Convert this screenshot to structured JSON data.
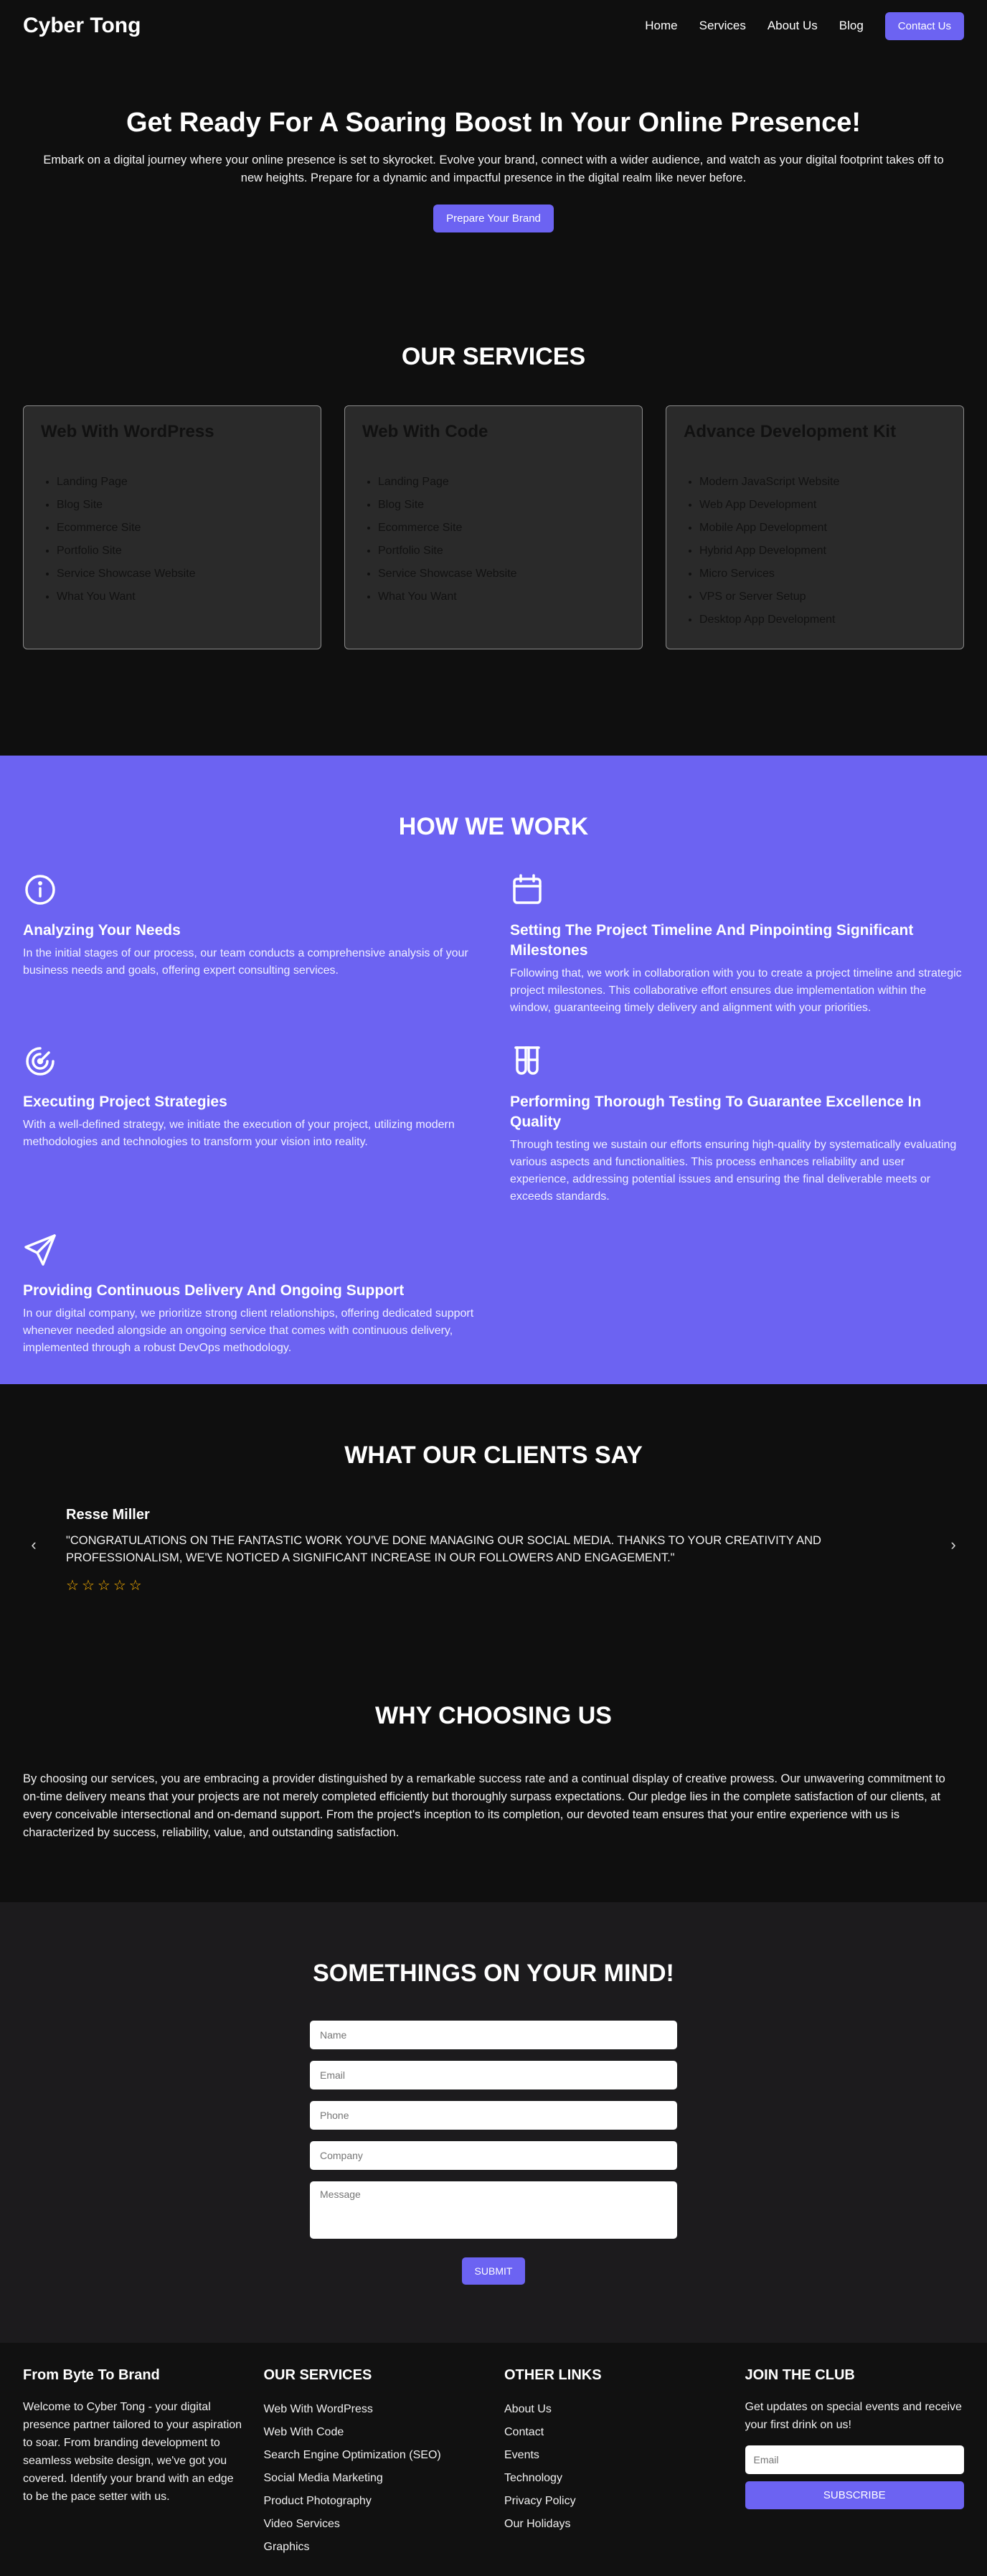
{
  "nav": {
    "logo": "Cyber Tong",
    "links": [
      "Home",
      "Services",
      "About Us",
      "Blog"
    ],
    "cta": "Contact Us"
  },
  "hero": {
    "title": "Get Ready For A Soaring Boost In Your Online Presence!",
    "text": "Embark on a digital journey where your online presence is set to skyrocket. Evolve your brand, connect with a wider audience, and watch as your digital footprint takes off to new heights. Prepare for a dynamic and impactful presence in the digital realm like never before.",
    "button": "Prepare Your Brand"
  },
  "services": {
    "title": "OUR SERVICES",
    "cards": [
      {
        "title": "Web With WordPress",
        "items": [
          "Landing Page",
          "Blog Site",
          "Ecommerce Site",
          "Portfolio Site",
          "Service Showcase Website",
          "What You Want"
        ]
      },
      {
        "title": "Web With Code",
        "items": [
          "Landing Page",
          "Blog Site",
          "Ecommerce Site",
          "Portfolio Site",
          "Service Showcase Website",
          "What You Want"
        ]
      },
      {
        "title": "Advance Development Kit",
        "items": [
          "Modern JavaScript Website",
          "Web App Development",
          "Mobile App Development",
          "Hybrid App Development",
          "Micro Services",
          "VPS or Server Setup",
          "Desktop App Development"
        ]
      }
    ]
  },
  "how": {
    "title": "HOW WE WORK",
    "items": [
      {
        "icon": "info-icon",
        "title": "Analyzing Your Needs",
        "text": "In the initial stages of our process, our team conducts a comprehensive analysis of your business needs and goals, offering expert consulting services."
      },
      {
        "icon": "calendar-icon",
        "title": "Setting The Project Timeline And Pinpointing Significant Milestones",
        "text": "Following that, we work in collaboration with you to create a project timeline and strategic project milestones. This collaborative effort ensures due implementation within the window, guaranteeing timely delivery and alignment with your priorities."
      },
      {
        "icon": "target-icon",
        "title": "Executing Project Strategies",
        "text": "With a well-defined strategy, we initiate the execution of your project, utilizing modern methodologies and technologies to transform your vision into reality."
      },
      {
        "icon": "test-tubes-icon",
        "title": "Performing Thorough Testing To Guarantee Excellence In Quality",
        "text": "Through testing we sustain our efforts ensuring high-quality by systematically evaluating various aspects and functionalities. This process enhances reliability and user experience, addressing potential issues and ensuring the final deliverable meets or exceeds standards."
      },
      {
        "icon": "send-icon",
        "title": "Providing Continuous Delivery And Ongoing Support",
        "text": "In our digital company, we prioritize strong client relationships, offering dedicated support whenever needed alongside an ongoing service that comes with continuous delivery, implemented through a robust DevOps methodology."
      }
    ]
  },
  "clients": {
    "title": "WHAT OUR CLIENTS SAY",
    "name": "Resse Miller",
    "quote": "\"CONGRATULATIONS ON THE FANTASTIC WORK YOU'VE DONE MANAGING OUR SOCIAL MEDIA. THANKS TO YOUR CREATIVITY AND PROFESSIONALISM, WE'VE NOTICED A SIGNIFICANT INCREASE IN OUR FOLLOWERS AND ENGAGEMENT.\"",
    "rating": 0,
    "max_rating": 5,
    "prev": "‹",
    "next": "›"
  },
  "why": {
    "title": "WHY CHOOSING US",
    "text": "By choosing our services, you are embracing a provider distinguished by a remarkable success rate and a continual display of creative prowess. Our unwavering commitment to on-time delivery means that your projects are not merely completed efficiently but thoroughly surpass expectations. Our pledge lies in the complete satisfaction of our clients, at every conceivable intersectional and on-demand support. From the project's inception to its completion, our devoted team ensures that your entire experience with us is characterized by success, reliability, value, and outstanding satisfaction."
  },
  "contact": {
    "title": "SOMETHINGS ON YOUR MIND!",
    "placeholders": {
      "name": "Name",
      "email": "Email",
      "phone": "Phone",
      "company": "Company",
      "message": "Message"
    },
    "submit": "SUBMIT"
  },
  "footer": {
    "about_title": "From Byte To Brand",
    "about_text": "Welcome to Cyber Tong - your digital presence partner tailored to your aspiration to soar. From branding development to seamless website design, we've got you covered. Identify your brand with an edge to be the pace setter with us.",
    "services_title": "OUR SERVICES",
    "services": [
      "Web With WordPress",
      "Web With Code",
      "Search Engine Optimization (SEO)",
      "Social Media Marketing",
      "Product Photography",
      "Video Services",
      "Graphics"
    ],
    "links_title": "OTHER LINKS",
    "links": [
      "About Us",
      "Contact",
      "Events",
      "Technology",
      "Privacy Policy",
      "Our Holidays"
    ],
    "club_title": "JOIN THE CLUB",
    "club_text": "Get updates on special events and receive your first drink on us!",
    "email_placeholder": "Email",
    "subscribe": "SUBSCRIBE"
  },
  "colors": {
    "accent": "#6c63f2",
    "bg": "#0f0f0f",
    "star": "#ffb400"
  }
}
